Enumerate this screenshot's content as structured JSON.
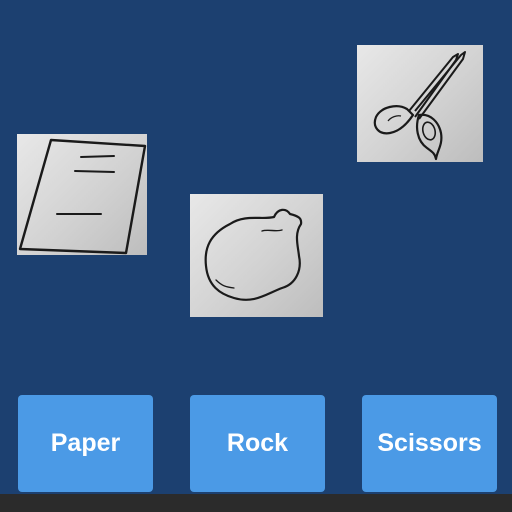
{
  "colors": {
    "background": "#1c4070",
    "button": "#4b9ae6",
    "button_text": "#ffffff",
    "card": "#d6d6d6",
    "bottom_bar": "#2b2b2b"
  },
  "cards": [
    {
      "name": "paper",
      "icon": "paper-sketch-icon"
    },
    {
      "name": "rock",
      "icon": "rock-sketch-icon"
    },
    {
      "name": "scissors",
      "icon": "scissors-sketch-icon"
    }
  ],
  "buttons": {
    "paper": "Paper",
    "rock": "Rock",
    "scissors": "Scissors"
  }
}
